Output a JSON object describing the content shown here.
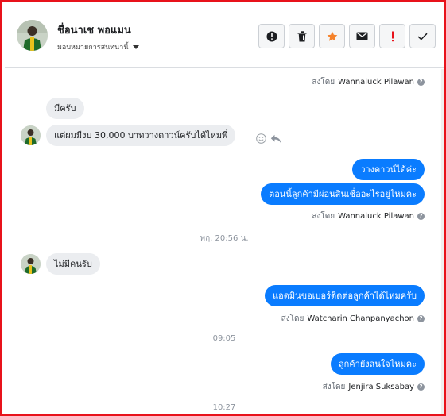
{
  "header": {
    "contact_name": "ชื่อนาเช พอแมน",
    "assign_label": "มอบหมายการสนทนานี้"
  },
  "toolbar": {
    "icons": [
      "info-icon",
      "trash-icon",
      "star-icon",
      "envelope-icon",
      "exclamation-icon",
      "check-icon"
    ],
    "star_color": "#f5822b",
    "exclamation_color": "#e8121b"
  },
  "colors": {
    "outgoing_bubble": "#0a7cff",
    "incoming_bubble": "#ebedf0",
    "frame_border": "#e8121b"
  },
  "thread": {
    "sent_by_prefix": "ส่งโดย",
    "sent_by_1": "Wannaluck Pilawan",
    "in_1": "มีครับ",
    "in_2": "แต่ผมมีงบ 30,000 บาทวางดาวน์ครับได้ไหมพี่",
    "out_1": "วางดาวน์ได้ค่ะ",
    "out_2": "ตอนนี้ลูกค้ามีผ่อนสินเชื่ออะไรอยู่ไหมคะ",
    "sent_by_2": "Wannaluck Pilawan",
    "time_1": "พฤ. 20:56 น.",
    "in_3": "ไม่มีคนรับ",
    "out_3": "แอดมินขอเบอร์ติดต่อลูกค้าได้ไหมครับ",
    "sent_by_3": "Watcharin Chanpanyachon",
    "time_2": "09:05",
    "out_4": "ลูกค้ายังสนใจไหมคะ",
    "sent_by_4": "Jenjira Suksabay",
    "time_3": "10:27"
  }
}
